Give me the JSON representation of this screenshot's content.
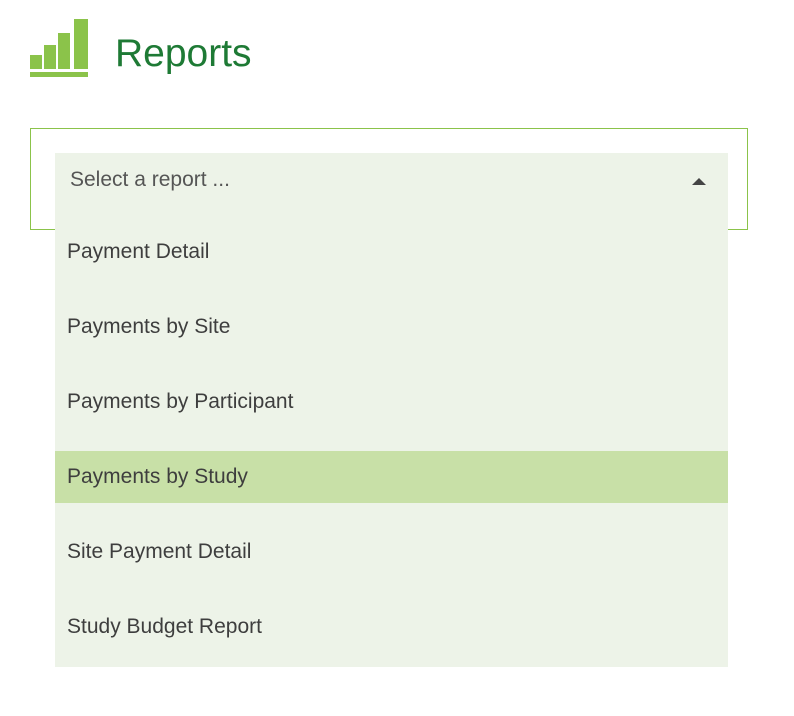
{
  "header": {
    "title": "Reports",
    "icon": "bar-chart-icon",
    "accent_color": "#1e7a35",
    "icon_color": "#8bc34a"
  },
  "report_select": {
    "placeholder": "Select a report ...",
    "is_open": true,
    "caret_icon": "caret-up-icon",
    "options": [
      {
        "label": "Payment Detail",
        "highlighted": false
      },
      {
        "label": "Payments by Site",
        "highlighted": false
      },
      {
        "label": "Payments by Participant",
        "highlighted": false
      },
      {
        "label": "Payments by Study",
        "highlighted": true
      },
      {
        "label": "Site Payment Detail",
        "highlighted": false
      },
      {
        "label": "Study Budget Report",
        "highlighted": false
      }
    ],
    "highlight_color": "#c8e0a7",
    "background_color": "#edf3e8",
    "border_color": "#8bc34a"
  }
}
